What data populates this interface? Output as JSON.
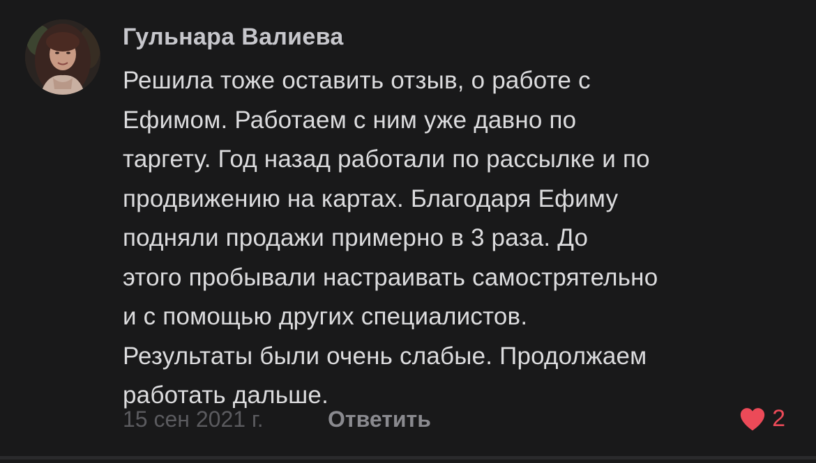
{
  "comment": {
    "author": "Гульнара Валиева",
    "text_lines": [
      "Решила тоже оставить  отзыв, о работе с",
      "Ефимом. Работаем с ним уже давно по",
      "таргету. Год назад работали по рассылке и по",
      "продвижению на картах. Благодаря Ефиму",
      "подняли продажи примерно в 3 раза. До",
      "этого пробывали настраивать самострятельно",
      "и с помощью других специалистов.",
      "Результаты были очень слабые. Продолжаем",
      "работать дальше."
    ],
    "date": "15 сен 2021 г.",
    "reply_label": "Ответить",
    "like_count": "2",
    "like_icon": "heart-icon",
    "colors": {
      "background": "#19191a",
      "author": "#c7c7cc",
      "text": "#dcdcde",
      "date": "#5b5b5f",
      "reply": "#8a8a8f",
      "like": "#ec4a58"
    }
  }
}
